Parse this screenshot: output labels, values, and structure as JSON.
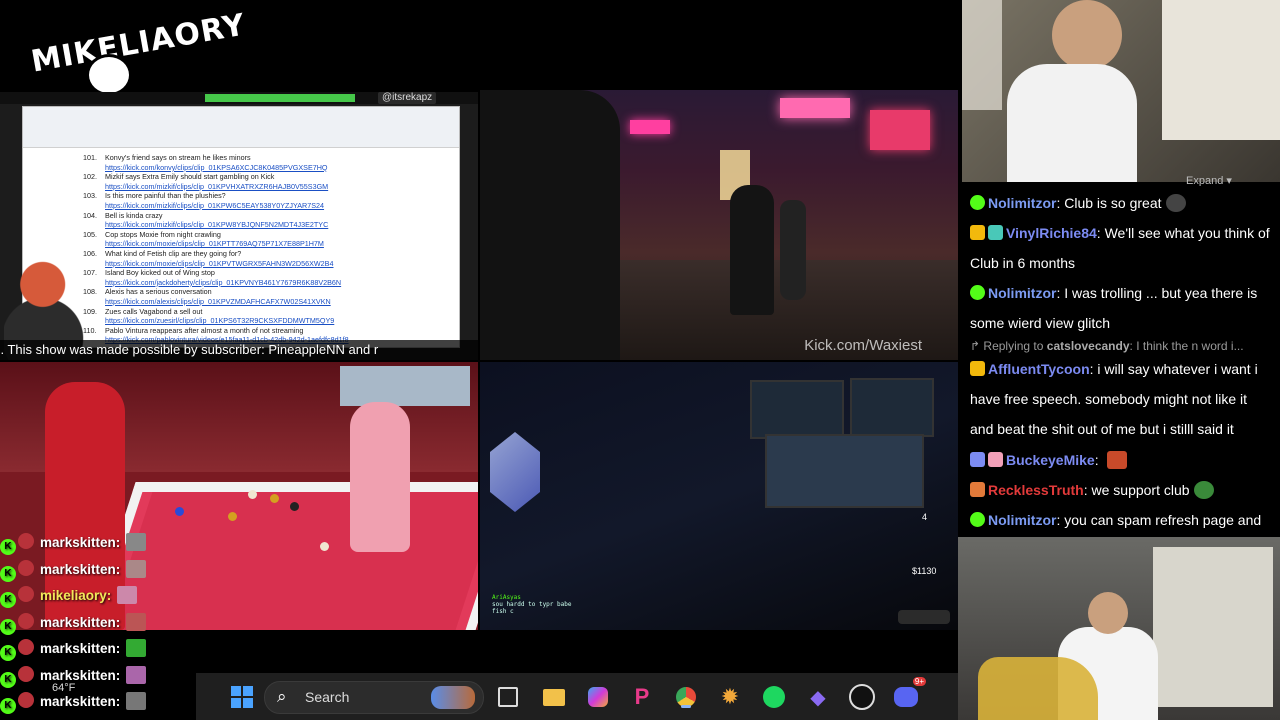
{
  "logo": {
    "text": "MIKELIAORY"
  },
  "doc_stream": {
    "handle": "@itsrekapz",
    "entries": [
      {
        "num": "101.",
        "title": "Konvy's friend says on stream he likes minors",
        "link": "https://kick.com/konvy/clips/clip_01KPSA6XCJC8K0485PVGXSE7HQ"
      },
      {
        "num": "102.",
        "title": "Mizkif says Extra Emily should start gambling on Kick",
        "link": "https://kick.com/mizkif/clips/clip_01KPVHXATRXZR6HAJB0V55S3GM"
      },
      {
        "num": "103.",
        "title": "Is this more painful than the plushies?",
        "link": "https://kick.com/mizkif/clips/clip_01KPW6C5EAY538Y0YZJYAR7S24"
      },
      {
        "num": "104.",
        "title": "Bell is kinda crazy",
        "link": "https://kick.com/mizkif/clips/clip_01KPW8YBJQNF5N2MDT4J3E2TYC"
      },
      {
        "num": "105.",
        "title": "Cop stops Moxie from night crawling",
        "link": "https://kick.com/moxie/clips/clip_01KPTT769AQ75P71X7E88P1H7M"
      },
      {
        "num": "106.",
        "title": "What kind of Fetish clip are they going for?",
        "link": "https://kick.com/moxie/clips/clip_01KPVTWGRX5FAHN3W2D56XW2B4"
      },
      {
        "num": "107.",
        "title": "Island Boy kicked out of Wing stop",
        "link": "https://kick.com/jackdoherty/clips/clip_01KPVNYB461Y7679R6K88V2B6N"
      },
      {
        "num": "108.",
        "title": "Alexis has a serious conversation",
        "link": "https://kick.com/alexis/clips/clip_01KPVZMDAFHCAFX7W02S41XVKN"
      },
      {
        "num": "109.",
        "title": "Zues calls Vagabond a sell out",
        "link": "https://kick.com/zuesirl/clips/clip_01KPS6T32R9CKSXFDDMWTM5QY9"
      },
      {
        "num": "110.",
        "title": "Pablo Vintura reappears after almost a month of not streaming",
        "link": "https://kick.com/pablovintura/videos/e15faa11-d1cb-42db-942d-1aefdfc8d1f8"
      }
    ],
    "subscriber_banner": "s. This show was made possible by subscriber: PineappleNN and r"
  },
  "street_stream": {
    "watermark": "Kick.com/Waxiest"
  },
  "desk_stream": {
    "chat_lines": [
      "AriAsyas",
      "sou hardd to typr babe",
      "fish c"
    ],
    "money": "$1130",
    "count": "4"
  },
  "right_chat": {
    "expand_label": "Expand",
    "messages": [
      {
        "user": "Nolimitzor",
        "color": "#7c9bf2",
        "text": "Club is so great"
      },
      {
        "user": "VinylRichie84",
        "color": "#7c8bf2",
        "text": "We'll see what you think of Club in 6 months"
      },
      {
        "user": "Nolimitzor",
        "color": "#7c9bf2",
        "text": "I was trolling ... but yea there is some wierd view glitch"
      },
      {
        "reply_prefix": "Replying to",
        "reply_user": "catslovecandy",
        "reply_text": "I think the n word i..."
      },
      {
        "user": "AffluentTycoon",
        "color": "#7c8bf2",
        "text": "i will say whatever i want i have free speech. somebody might not like it and beat the shit out of me but i stilll said it"
      },
      {
        "user": "BuckeyeMike",
        "color": "#7c8bf2",
        "text": ""
      },
      {
        "user": "RecklessTruth",
        "color": "#e23a3a",
        "text": "we support club"
      },
      {
        "user": "Nolimitzor",
        "color": "#7c9bf2",
        "text": "you can spam refresh page and"
      }
    ]
  },
  "left_chat": {
    "rows": [
      {
        "user": "markskitten:",
        "color": "#ffffff"
      },
      {
        "user": "markskitten:",
        "color": "#ffffff"
      },
      {
        "user": "mikeliaory:",
        "color": "#f2e85a"
      },
      {
        "user": "markskitten:",
        "color": "#ffffff"
      },
      {
        "user": "markskitten:",
        "color": "#ffffff"
      },
      {
        "user": "markskitten:",
        "color": "#ffffff"
      },
      {
        "user": "markskitten:",
        "color": "#ffffff"
      }
    ]
  },
  "taskbar": {
    "temperature": "64°F",
    "search_label": "Search",
    "icons": [
      "windows-start-icon",
      "search-icon",
      "file-explorer-icon",
      "folder-icon",
      "copilot-icon",
      "picsart-icon",
      "chrome-icon",
      "sun-app-icon",
      "spotify-icon",
      "obsidian-icon",
      "obs-icon",
      "discord-icon"
    ],
    "discord_badge": "9+"
  }
}
